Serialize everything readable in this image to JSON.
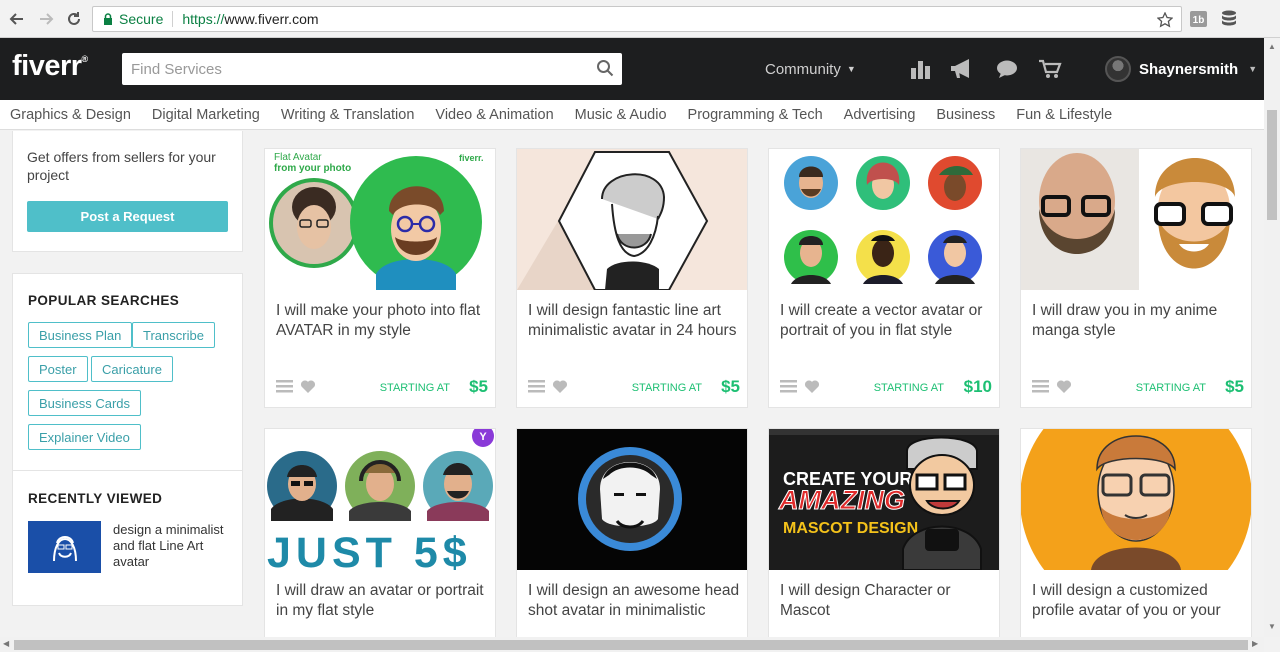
{
  "browser": {
    "secure_label": "Secure",
    "url_scheme": "https://",
    "url_host": "www.fiverr.com"
  },
  "header": {
    "logo": "fiverr",
    "search_placeholder": "Find Services",
    "community": "Community",
    "username": "Shaynersmith"
  },
  "categories": [
    "Graphics & Design",
    "Digital Marketing",
    "Writing & Translation",
    "Video & Animation",
    "Music & Audio",
    "Programming & Tech",
    "Advertising",
    "Business",
    "Fun & Lifestyle"
  ],
  "sidebar": {
    "offers_text": "Get offers from sellers for your project",
    "post_request": "Post a Request",
    "popular_title": "POPULAR SEARCHES",
    "tags": [
      "Business Plan",
      "Transcribe",
      "Poster",
      "Caricature",
      "Business Cards",
      "Explainer Video"
    ],
    "recent_title": "RECENTLY VIEWED",
    "recent_item": "design a minimalist and flat Line Art avatar"
  },
  "gigs": [
    {
      "title": "I will make your photo into flat AVATAR in my style",
      "starting": "STARTING AT",
      "price": "$5",
      "overlay_1": "Flat Avatar",
      "overlay_2": "from your photo",
      "overlay_brand": "fiverr."
    },
    {
      "title": "I will design fantastic line art minimalistic avatar in 24 hours",
      "starting": "STARTING AT",
      "price": "$5"
    },
    {
      "title": "I will create a vector avatar or portrait of you in flat style",
      "starting": "STARTING AT",
      "price": "$10"
    },
    {
      "title": "I will draw you in my anime manga style",
      "starting": "STARTING AT",
      "price": "$5"
    },
    {
      "title": "I will draw an avatar or portrait in my flat style",
      "overlay": "JUST  5$",
      "badge": "Y"
    },
    {
      "title": "I will design an awesome head shot avatar in minimalistic"
    },
    {
      "title": "I will design Character or Mascot",
      "overlay_1": "CREATE YOUR",
      "overlay_2": "AMAZING",
      "overlay_3": "MASCOT DESIGN"
    },
    {
      "title": "I will design a customized profile avatar of you or your"
    }
  ],
  "colors": {
    "brand_green": "#1dbf73",
    "teal": "#4fbfc9",
    "header_bg": "#1d1e1f"
  }
}
